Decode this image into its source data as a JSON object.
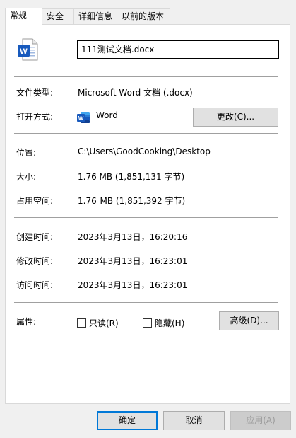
{
  "tabs": [
    {
      "label": "常规",
      "active": true
    },
    {
      "label": "安全",
      "active": false
    },
    {
      "label": "详细信息",
      "active": false
    },
    {
      "label": "以前的版本",
      "active": false
    }
  ],
  "file": {
    "icon": "word-document-icon",
    "name": "111测试文档.docx"
  },
  "type_section": {
    "type_label": "文件类型:",
    "type_value": "Microsoft Word 文档 (.docx)",
    "opens_with_label": "打开方式:",
    "app_icon": "word-app-icon",
    "app_name": "Word",
    "change_button": "更改(C)..."
  },
  "location_section": {
    "location_label": "位置:",
    "location_value": "C:\\Users\\GoodCooking\\Desktop",
    "size_label": "大小:",
    "size_value": "1.76 MB (1,851,131 字节)",
    "disk_size_label": "占用空间:",
    "disk_size_value_a": "1.76",
    "disk_size_value_b": " MB (1,851,392 字节)"
  },
  "time_section": {
    "created_label": "创建时间:",
    "created_value": "2023年3月13日，16:20:16",
    "modified_label": "修改时间:",
    "modified_value": "2023年3月13日，16:23:01",
    "accessed_label": "访问时间:",
    "accessed_value": "2023年3月13日，16:23:01"
  },
  "attributes": {
    "label": "属性:",
    "readonly_label": "只读(R)",
    "readonly_checked": false,
    "hidden_label": "隐藏(H)",
    "hidden_checked": false,
    "advanced_button": "高级(D)..."
  },
  "footer": {
    "ok_button": "确定",
    "cancel_button": "取消",
    "apply_button": "应用(A)",
    "apply_enabled": false
  },
  "colors": {
    "accent": "#0078d7",
    "word_blue": "#185abd",
    "dialog_bg": "#f0f0f0",
    "panel_bg": "#ffffff"
  }
}
